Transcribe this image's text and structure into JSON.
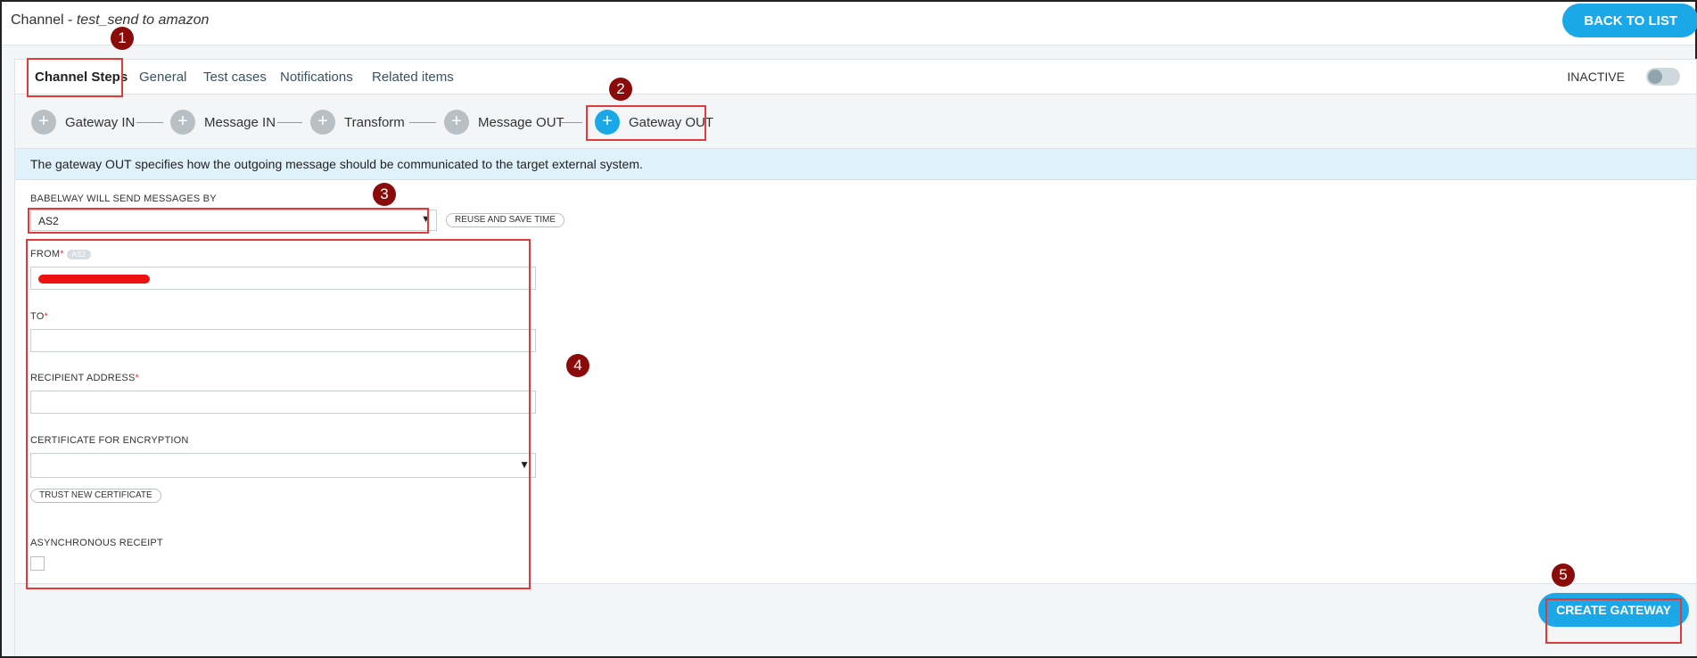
{
  "header": {
    "title_prefix": "Channel - ",
    "title_name": "test_send to amazon",
    "back_label": "BACK TO LIST"
  },
  "tabs": [
    "Channel Steps",
    "General",
    "Test cases",
    "Notifications",
    "Related items"
  ],
  "status": {
    "label": "INACTIVE"
  },
  "steps": [
    "Gateway IN",
    "Message IN",
    "Transform",
    "Message OUT",
    "Gateway OUT"
  ],
  "info": "The gateway OUT specifies how the outgoing message should be communicated to the target external system.",
  "form": {
    "send_by_label": "BABELWAY WILL SEND MESSAGES BY",
    "send_by_value": "AS2",
    "reuse_label": "REUSE AND SAVE TIME",
    "from_label": "FROM",
    "from_badge": "AS2",
    "to_label": "TO",
    "recipient_label": "RECIPIENT ADDRESS",
    "cert_label": "CERTIFICATE FOR ENCRYPTION",
    "cert_value": "",
    "trust_label": "TRUST NEW CERTIFICATE",
    "async_label": "ASYNCHRONOUS RECEIPT",
    "required_mark": "*"
  },
  "footer": {
    "create_label": "CREATE GATEWAY"
  },
  "annotations": [
    "1",
    "2",
    "3",
    "4",
    "5"
  ],
  "colors": {
    "accent": "#1ba8e8",
    "highlight": "#e03a3a",
    "marker": "#8b0a0a"
  }
}
